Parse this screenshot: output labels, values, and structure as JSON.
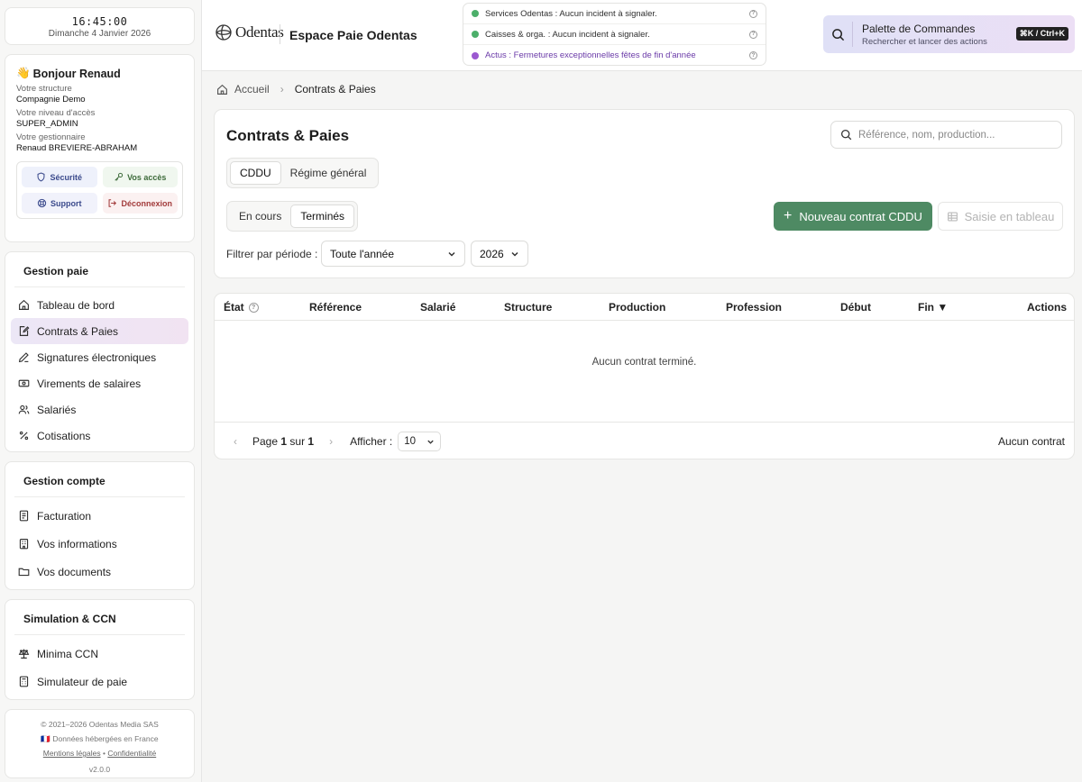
{
  "clock": {
    "time": "16:45:00",
    "date": "Dimanche 4 Janvier 2026"
  },
  "user": {
    "hello_emoji": "👋",
    "hello": "Bonjour Renaud",
    "structure_label": "Votre structure",
    "structure": "Compagnie Demo",
    "level_label": "Votre niveau d'accès",
    "level": "SUPER_ADMIN",
    "manager_label": "Votre gestionnaire",
    "manager": "Renaud BREVIERE-ABRAHAM",
    "quick": {
      "security": "Sécurité",
      "access": "Vos accès",
      "support": "Support",
      "logout": "Déconnexion"
    }
  },
  "nav": {
    "pay": {
      "title": "Gestion paie",
      "items": [
        "Tableau de bord",
        "Contrats & Paies",
        "Signatures électroniques",
        "Virements de salaires",
        "Salariés",
        "Cotisations"
      ]
    },
    "account": {
      "title": "Gestion compte",
      "items": [
        "Facturation",
        "Vos informations",
        "Vos documents"
      ]
    },
    "sim": {
      "title": "Simulation & CCN",
      "items": [
        "Minima CCN",
        "Simulateur de paie"
      ]
    }
  },
  "footer": {
    "copyright": "© 2021–2026 Odentas Media SAS",
    "flag": "🇫🇷",
    "hosting": "Données hébergées en France",
    "legal": "Mentions légales",
    "sep": "•",
    "privacy": "Confidentialité",
    "version": "v2.0.0"
  },
  "header": {
    "logo_text": "Odentas",
    "app_title": "Espace Paie Odentas",
    "status": [
      {
        "text": "Services Odentas : Aucun incident à signaler.",
        "color": "#4caf6a"
      },
      {
        "text": "Caisses & orga. : Aucun incident à signaler.",
        "color": "#4caf6a"
      },
      {
        "text": "Actus : Fermetures exceptionnelles fêtes de fin d'année",
        "color": "#9b59d0"
      }
    ],
    "palette_title": "Palette de Commandes",
    "palette_sub": "Rechercher et lancer des actions",
    "palette_kbd": "⌘K / Ctrl+K"
  },
  "breadcrumb": {
    "home": "Accueil",
    "current": "Contrats & Paies"
  },
  "main": {
    "title": "Contrats & Paies",
    "search_placeholder": "Référence, nom, production...",
    "regime_tabs": [
      "CDDU",
      "Régime général"
    ],
    "status_tabs": [
      "En cours",
      "Terminés"
    ],
    "new_button": "Nouveau contrat CDDU",
    "saisie_button": "Saisie en tableau",
    "filter_label": "Filtrer par période :",
    "period_value": "Toute l'année",
    "year_value": "2026"
  },
  "table": {
    "columns": [
      "État",
      "Référence",
      "Salarié",
      "Structure",
      "Production",
      "Profession",
      "Début",
      "Fin ▼",
      "Actions"
    ],
    "empty": "Aucun contrat terminé.",
    "page_prefix": "Page",
    "page_current": "1",
    "page_of": "sur",
    "page_total": "1",
    "show_label": "Afficher :",
    "per_page": "10",
    "count": "Aucun contrat"
  },
  "colors": {
    "accent": "#4e8a63",
    "nav_active": "#ece7f6"
  }
}
